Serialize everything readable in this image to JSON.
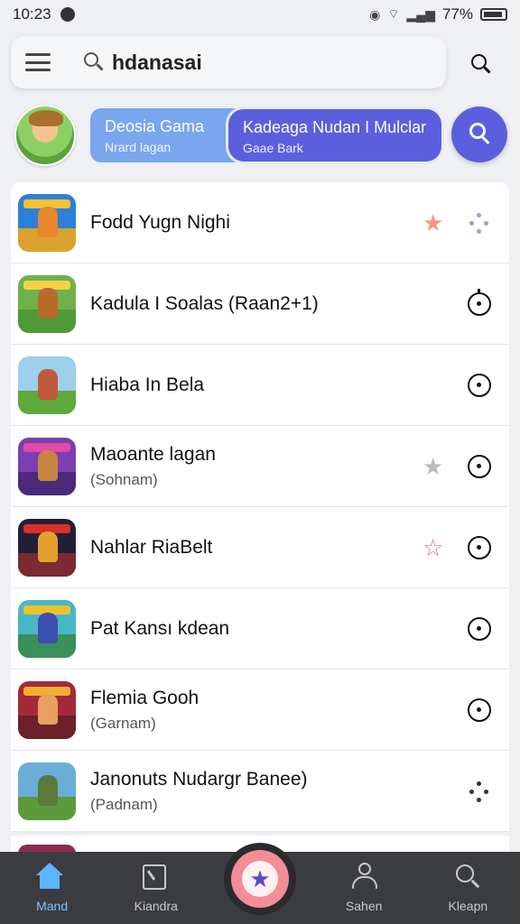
{
  "status_bar": {
    "time": "10:23",
    "battery": "77%"
  },
  "search": {
    "query": "hdanasai"
  },
  "header": {
    "card_left": {
      "title": "Deosia Gama",
      "subtitle": "Nrard lagan"
    },
    "card_right": {
      "title": "Kadeaga Nudan I Mulclar",
      "subtitle": "Gaae Bark"
    }
  },
  "games": [
    {
      "title": "Fodd Yugn Nighi",
      "subtitle": "",
      "star": "filled",
      "star_color": "#f39a7c",
      "action_icon": "dots-icon"
    },
    {
      "title": "Kadula I Soalas (Raan2+1)",
      "subtitle": "",
      "star": "",
      "star_color": "",
      "action_icon": "target-icon"
    },
    {
      "title": "Hiaba In Bela",
      "subtitle": "",
      "star": "",
      "star_color": "",
      "action_icon": "target-icon"
    },
    {
      "title": "Maoante lagan",
      "subtitle": "(Sohnam)",
      "star": "filled",
      "star_color": "#b7bcc6",
      "action_icon": "target-icon"
    },
    {
      "title": "Nahlar RiaBelt",
      "subtitle": "",
      "star": "outline",
      "star_color": "#e0737a",
      "action_icon": "target-icon"
    },
    {
      "title": "Pat Kansı kdean",
      "subtitle": "",
      "star": "",
      "star_color": "",
      "action_icon": "target-icon"
    },
    {
      "title": "Flemia Gooh",
      "subtitle": "(Garnam)",
      "star": "",
      "star_color": "",
      "action_icon": "target-icon"
    },
    {
      "title": "Janonuts Nudargr Banee)",
      "subtitle": "(Padnam)",
      "star": "",
      "star_color": "",
      "action_icon": "dots-icon"
    }
  ],
  "nav": {
    "home": "Mand",
    "calendar": "Kiandra",
    "profile": "Sahen",
    "search": "Kleapn"
  },
  "colors": {
    "accent": "#5b5fde",
    "nav_active": "#5fb4ff",
    "fab": "#f48c97"
  }
}
